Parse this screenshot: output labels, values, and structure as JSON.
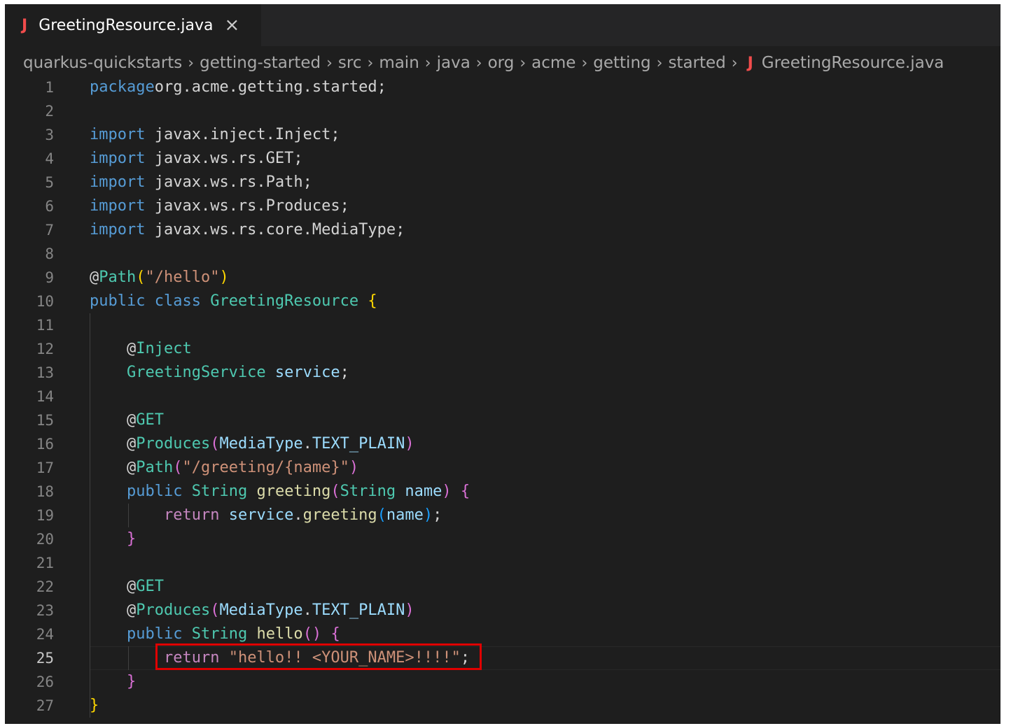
{
  "tab": {
    "icon": "java-file-icon",
    "label": "GreetingResource.java",
    "close_icon": "close-icon"
  },
  "breadcrumb": [
    "quarkus-quickstarts",
    "getting-started",
    "src",
    "main",
    "java",
    "org",
    "acme",
    "getting",
    "started",
    "GreetingResource.java"
  ],
  "editor": {
    "active_line": 25,
    "highlighted_line": 25,
    "lines": [
      [
        [
          "kw",
          "package"
        ],
        [
          "",
          "org.acme.getting.started;"
        ]
      ],
      [],
      [
        [
          "kw",
          "import"
        ],
        [
          "",
          " javax.inject.Inject;"
        ]
      ],
      [
        [
          "kw",
          "import"
        ],
        [
          "",
          " javax.ws.rs.GET;"
        ]
      ],
      [
        [
          "kw",
          "import"
        ],
        [
          "",
          " javax.ws.rs.Path;"
        ]
      ],
      [
        [
          "kw",
          "import"
        ],
        [
          "",
          " javax.ws.rs.Produces;"
        ]
      ],
      [
        [
          "kw",
          "import"
        ],
        [
          "",
          " javax.ws.rs.core.MediaType;"
        ]
      ],
      [],
      [
        [
          "",
          "@"
        ],
        [
          "ty",
          "Path"
        ],
        [
          "br1",
          "("
        ],
        [
          "str",
          "\"/hello\""
        ],
        [
          "br1",
          ")"
        ]
      ],
      [
        [
          "kw",
          "public"
        ],
        [
          "",
          " "
        ],
        [
          "kw",
          "class"
        ],
        [
          "",
          " "
        ],
        [
          "ty",
          "GreetingResource"
        ],
        [
          "",
          " "
        ],
        [
          "br1",
          "{"
        ]
      ],
      [],
      [
        [
          "",
          "    @"
        ],
        [
          "ty",
          "Inject"
        ]
      ],
      [
        [
          "",
          "    "
        ],
        [
          "ty",
          "GreetingService"
        ],
        [
          "",
          " "
        ],
        [
          "var",
          "service"
        ],
        [
          "",
          ";"
        ]
      ],
      [],
      [
        [
          "",
          "    @"
        ],
        [
          "ty",
          "GET"
        ]
      ],
      [
        [
          "",
          "    @"
        ],
        [
          "ty",
          "Produces"
        ],
        [
          "br2",
          "("
        ],
        [
          "var",
          "MediaType"
        ],
        [
          "",
          "."
        ],
        [
          "var",
          "TEXT_PLAIN"
        ],
        [
          "br2",
          ")"
        ]
      ],
      [
        [
          "",
          "    @"
        ],
        [
          "ty",
          "Path"
        ],
        [
          "br2",
          "("
        ],
        [
          "str",
          "\"/greeting/{name}\""
        ],
        [
          "br2",
          ")"
        ]
      ],
      [
        [
          "",
          "    "
        ],
        [
          "kw",
          "public"
        ],
        [
          "",
          " "
        ],
        [
          "ty",
          "String"
        ],
        [
          "",
          " "
        ],
        [
          "fn",
          "greeting"
        ],
        [
          "br2",
          "("
        ],
        [
          "ty",
          "String"
        ],
        [
          "",
          " "
        ],
        [
          "var",
          "name"
        ],
        [
          "br2",
          ")"
        ],
        [
          "",
          " "
        ],
        [
          "br2",
          "{"
        ]
      ],
      [
        [
          "",
          "        "
        ],
        [
          "ctl",
          "return"
        ],
        [
          "",
          " "
        ],
        [
          "var",
          "service"
        ],
        [
          "",
          "."
        ],
        [
          "fn",
          "greeting"
        ],
        [
          "br3",
          "("
        ],
        [
          "var",
          "name"
        ],
        [
          "br3",
          ")"
        ],
        [
          "",
          ";"
        ]
      ],
      [
        [
          "",
          "    "
        ],
        [
          "br2",
          "}"
        ]
      ],
      [],
      [
        [
          "",
          "    @"
        ],
        [
          "ty",
          "GET"
        ]
      ],
      [
        [
          "",
          "    @"
        ],
        [
          "ty",
          "Produces"
        ],
        [
          "br2",
          "("
        ],
        [
          "var",
          "MediaType"
        ],
        [
          "",
          "."
        ],
        [
          "var",
          "TEXT_PLAIN"
        ],
        [
          "br2",
          ")"
        ]
      ],
      [
        [
          "",
          "    "
        ],
        [
          "kw",
          "public"
        ],
        [
          "",
          " "
        ],
        [
          "ty",
          "String"
        ],
        [
          "",
          " "
        ],
        [
          "fn",
          "hello"
        ],
        [
          "br2",
          "()"
        ],
        [
          "",
          " "
        ],
        [
          "br2",
          "{"
        ]
      ],
      [
        [
          "",
          "        "
        ],
        [
          "ctl",
          "return"
        ],
        [
          "",
          " "
        ],
        [
          "str",
          "\"hello!! <YOUR_NAME>!!!!\""
        ],
        [
          "",
          ";"
        ]
      ],
      [
        [
          "",
          "    "
        ],
        [
          "br2",
          "}"
        ]
      ],
      [
        [
          "br1",
          "}"
        ]
      ]
    ]
  },
  "colors": {
    "editor_bg": "#1e1e1e",
    "highlight_border": "#e00000",
    "java_icon": "#f14c4c"
  }
}
